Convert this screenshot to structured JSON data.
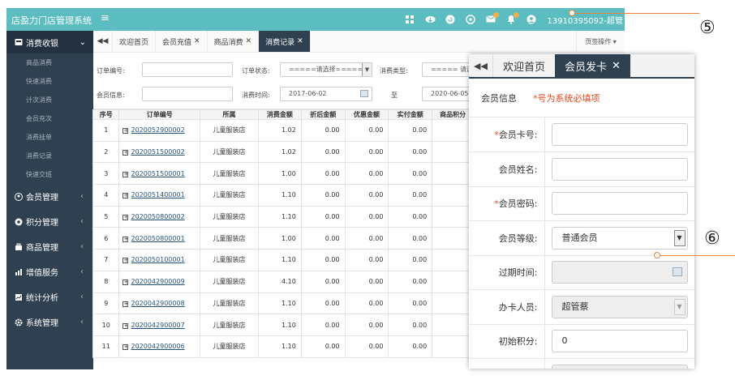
{
  "header": {
    "brand": "店盈力门店管理系统",
    "menu_toggle": "≡",
    "user": "13910395092-超管",
    "icons": [
      "grid-icon",
      "cloud-download-icon",
      "refresh-icon",
      "settings-icon",
      "mail-icon",
      "bell-icon",
      "user-icon"
    ],
    "badge_color": "#f0ad4e"
  },
  "sidebar": {
    "active_group": "消费收银",
    "sub_items": [
      "商品消费",
      "快速消费",
      "计次消费",
      "会员充次",
      "消费挂单",
      "消费记录",
      "快速交班"
    ],
    "items": [
      {
        "label": "会员管理",
        "icon": "members-icon"
      },
      {
        "label": "积分管理",
        "icon": "points-icon"
      },
      {
        "label": "商品管理",
        "icon": "goods-icon"
      },
      {
        "label": "增值服务",
        "icon": "chart-icon"
      },
      {
        "label": "统计分析",
        "icon": "stats-icon"
      },
      {
        "label": "系统管理",
        "icon": "gear-icon"
      }
    ]
  },
  "tabs": {
    "nav": "◀◀",
    "items": [
      {
        "label": "欢迎首页",
        "closable": false,
        "active": false
      },
      {
        "label": "会员充值",
        "closable": true,
        "active": false
      },
      {
        "label": "商品消费",
        "closable": true,
        "active": false
      },
      {
        "label": "消费记录",
        "closable": true,
        "active": true
      }
    ],
    "page_ops": "页签操作"
  },
  "filters": {
    "order_no_label": "订单编号:",
    "order_status_label": "订单状态:",
    "order_status_value": "=====请选择=====",
    "consume_type_label": "消费类型:",
    "consume_type_value": "===== 请选择",
    "member_info_label": "会员信息:",
    "consume_time_label": "消费时间:",
    "date_from": "2017-06-02",
    "to_label": "至",
    "date_to": "2020-06-05"
  },
  "table": {
    "headers": [
      "序号",
      "订单编号",
      "所属",
      "消费金额",
      "折后金额",
      "优惠金额",
      "实付金额",
      "商品积分"
    ],
    "rows": [
      {
        "no": "1",
        "order": "2020052900002",
        "store": "儿童服装店",
        "amount": "1.02",
        "discounted": "0.00",
        "benefit": "0.00",
        "paid": "0.00"
      },
      {
        "no": "2",
        "order": "2020051500002",
        "store": "儿童服装店",
        "amount": "1.02",
        "discounted": "0.00",
        "benefit": "0.00",
        "paid": "0.00"
      },
      {
        "no": "3",
        "order": "2020051500001",
        "store": "儿童服装店",
        "amount": "1.00",
        "discounted": "0.00",
        "benefit": "0.00",
        "paid": "0.00"
      },
      {
        "no": "4",
        "order": "2020051400001",
        "store": "儿童服装店",
        "amount": "1.10",
        "discounted": "0.00",
        "benefit": "0.00",
        "paid": "0.00"
      },
      {
        "no": "5",
        "order": "2020050800002",
        "store": "儿童服装店",
        "amount": "1.10",
        "discounted": "0.00",
        "benefit": "0.00",
        "paid": "0.00"
      },
      {
        "no": "6",
        "order": "2020050800001",
        "store": "儿童服装店",
        "amount": "1.00",
        "discounted": "0.00",
        "benefit": "0.00",
        "paid": "0.00"
      },
      {
        "no": "7",
        "order": "2020050100001",
        "store": "儿童服装店",
        "amount": "1.10",
        "discounted": "0.00",
        "benefit": "0.00",
        "paid": "0.00"
      },
      {
        "no": "8",
        "order": "2020042900009",
        "store": "儿童服装店",
        "amount": "4.10",
        "discounted": "0.00",
        "benefit": "0.00",
        "paid": "0.00"
      },
      {
        "no": "9",
        "order": "2020042900008",
        "store": "儿童服装店",
        "amount": "1.10",
        "discounted": "0.00",
        "benefit": "0.00",
        "paid": "0.00"
      },
      {
        "no": "10",
        "order": "2020042900007",
        "store": "儿童服装店",
        "amount": "1.10",
        "discounted": "0.00",
        "benefit": "0.00",
        "paid": "0.00"
      },
      {
        "no": "11",
        "order": "2020042900006",
        "store": "儿童服装店",
        "amount": "1.10",
        "discounted": "0.00",
        "benefit": "0.00",
        "paid": "0.00"
      }
    ]
  },
  "modal": {
    "nav": "◀◀",
    "tab_home": "欢迎首页",
    "tab_active": "会员发卡",
    "section_title": "会员信息",
    "required_note": "*号为系统必填项",
    "fields": [
      {
        "label": "会员卡号:",
        "required": true,
        "value": ""
      },
      {
        "label": "会员姓名:",
        "required": false,
        "value": ""
      },
      {
        "label": "会员密码:",
        "required": true,
        "value": ""
      },
      {
        "label": "会员等级:",
        "required": false,
        "value": "普通会员"
      },
      {
        "label": "过期时间:",
        "required": false,
        "value": ""
      },
      {
        "label": "办卡人员:",
        "required": false,
        "value": "超管蔡"
      },
      {
        "label": "初始积分:",
        "required": false,
        "value": "0"
      }
    ]
  },
  "callouts": {
    "five": "⑤",
    "six": "⑥",
    "leader_color": "#e8833a"
  }
}
